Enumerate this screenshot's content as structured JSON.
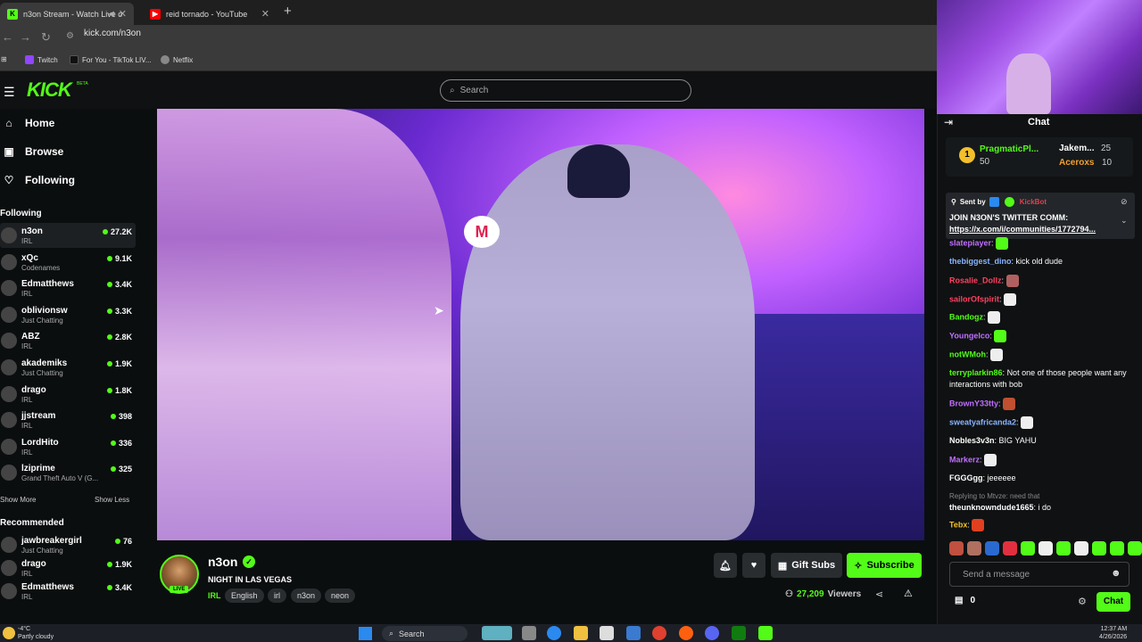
{
  "browser": {
    "tabs": [
      {
        "title": "n3on Stream - Watch Live o",
        "active": true,
        "favicon": "kick-icon"
      },
      {
        "title": "reid tornado - YouTube",
        "active": false,
        "favicon": "youtube-icon"
      }
    ],
    "url": "kick.com/n3on",
    "bookmarks": [
      {
        "label": "Twitch",
        "icon": "twitch-icon"
      },
      {
        "label": "For You - TikTok LIV...",
        "icon": "tiktok-icon"
      },
      {
        "label": "Netflix",
        "icon": "globe-icon"
      }
    ]
  },
  "kick": {
    "logo": "KICK",
    "beta": "BETA",
    "search_placeholder": "Search"
  },
  "sidebar": {
    "nav": [
      {
        "label": "Home",
        "icon": "⌂"
      },
      {
        "label": "Browse",
        "icon": "▣"
      },
      {
        "label": "Following",
        "icon": "♡"
      }
    ],
    "following_title": "Following",
    "following": [
      {
        "name": "n3on",
        "category": "IRL",
        "viewers": "27.2K"
      },
      {
        "name": "xQc",
        "category": "Codenames",
        "viewers": "9.1K"
      },
      {
        "name": "Edmatthews",
        "category": "IRL",
        "viewers": "3.4K"
      },
      {
        "name": "oblivionsw",
        "category": "Just Chatting",
        "viewers": "3.3K"
      },
      {
        "name": "ABZ",
        "category": "IRL",
        "viewers": "2.8K"
      },
      {
        "name": "akademiks",
        "category": "Just Chatting",
        "viewers": "1.9K"
      },
      {
        "name": "drago",
        "category": "IRL",
        "viewers": "1.8K"
      },
      {
        "name": "jjstream",
        "category": "IRL",
        "viewers": "398"
      },
      {
        "name": "LordHito",
        "category": "IRL",
        "viewers": "336"
      },
      {
        "name": "lziprime",
        "category": "Grand Theft Auto V (G...",
        "viewers": "325"
      }
    ],
    "show_more": "Show More",
    "show_less": "Show Less",
    "recommended_title": "Recommended",
    "recommended": [
      {
        "name": "jawbreakergirl",
        "category": "Just Chatting",
        "viewers": "76"
      },
      {
        "name": "drago",
        "category": "IRL",
        "viewers": "1.9K"
      },
      {
        "name": "Edmatthews",
        "category": "IRL",
        "viewers": "3.4K"
      }
    ]
  },
  "stream": {
    "live_label": "LIVE",
    "name": "n3on",
    "title": "NIGHT IN LAS VEGAS",
    "category": "IRL",
    "tags": [
      "English",
      "irl",
      "n3on",
      "neon"
    ],
    "gift_subs": "Gift Subs",
    "subscribe": "Subscribe",
    "viewers": "27,209",
    "viewers_label": "Viewers"
  },
  "chat": {
    "title": "Chat",
    "leaderboard": [
      {
        "rank": "1",
        "name": "PragmaticPl...",
        "value": "50"
      },
      {
        "name": "Jakem...",
        "value": "25"
      },
      {
        "name": "Aceroxs",
        "value": "10"
      }
    ],
    "pinned": {
      "sent_by_label": "Sent by",
      "sender": "KickBot",
      "text": "JOIN N3ON'S TWITTER COMM:",
      "link": "https://x.com/i/communities/1772794..."
    },
    "messages": [
      {
        "user": "slatepiayer",
        "text": "",
        "color": "#c070ff"
      },
      {
        "user": "thebiggest_dino",
        "text": "kick old dude",
        "color": "#8ab4ff"
      },
      {
        "user": "Rosalie_Dollz",
        "text": "",
        "color": "#ff4060"
      },
      {
        "user": "sailorOfspirit",
        "text": "",
        "color": "#ff4060"
      },
      {
        "user": "Bandogz",
        "text": "",
        "color": "#53fc18"
      },
      {
        "user": "Youngelco",
        "text": "",
        "color": "#c070ff"
      },
      {
        "user": "notWMoh",
        "text": "",
        "color": "#53fc18"
      },
      {
        "user": "terryplarkin86",
        "text": "Not one of those people want any interactions with bob",
        "color": "#53fc18"
      },
      {
        "user": "BrownY33tty",
        "text": "",
        "color": "#c070ff"
      },
      {
        "user": "sweatyafricanda2",
        "text": "",
        "color": "#8ab4ff"
      },
      {
        "user": "Nobles3v3n",
        "text": "BIG YAHU",
        "color": "#ffffff"
      },
      {
        "user": "Markerz",
        "text": "",
        "color": "#c070ff"
      },
      {
        "user": "FGGGgg",
        "text": "jeeeeee",
        "color": "#ffffff"
      },
      {
        "user": "theunknowndude1665",
        "text": "i do",
        "color": "#ffffff",
        "reply": "Replying to Mtvze: need that"
      },
      {
        "user": "Tebx",
        "text": "",
        "color": "#f2c02a"
      }
    ],
    "input_placeholder": "Send a message",
    "points": "0",
    "chat_button": "Chat"
  },
  "taskbar": {
    "temp": "-4°C",
    "weather": "Partly cloudy",
    "search": "Search",
    "time": "12:37 AM",
    "date": "4/26/2026"
  }
}
